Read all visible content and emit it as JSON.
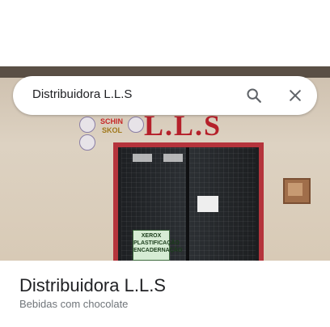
{
  "search": {
    "query": "Distribuidora L.L.S"
  },
  "photo": {
    "store_sign": "L.L.S",
    "sticker_brand_1": "SCHIN",
    "sticker_brand_2": "SKOL",
    "door_sign_lines": [
      "XEROX",
      "PLASTIFICAÇÃO",
      "ENCADERNAÇÃO"
    ]
  },
  "place": {
    "name": "Distribuidora L.L.S",
    "category": "Bebidas com chocolate"
  },
  "icons": {
    "search": "search-icon",
    "close": "close-icon"
  },
  "colors": {
    "sign_red": "#b5202a",
    "text_primary": "#202124",
    "text_secondary": "#70757a"
  }
}
